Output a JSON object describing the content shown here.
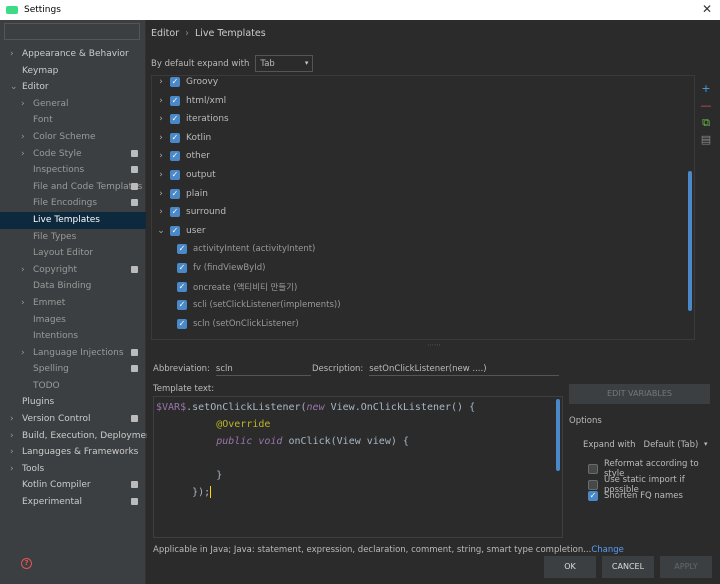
{
  "window": {
    "title": "Settings",
    "controls": "✕"
  },
  "sidebar": {
    "search_placeholder": "",
    "items": [
      {
        "label": "Appearance & Behavior",
        "level": 0,
        "arrow": "›",
        "badge": false
      },
      {
        "label": "Keymap",
        "level": 0,
        "arrow": "",
        "badge": false
      },
      {
        "label": "Editor",
        "level": 0,
        "arrow": "⌄",
        "badge": false
      },
      {
        "label": "General",
        "level": 1,
        "arrow": "›",
        "badge": false
      },
      {
        "label": "Font",
        "level": 1,
        "arrow": "",
        "badge": false
      },
      {
        "label": "Color Scheme",
        "level": 1,
        "arrow": "›",
        "badge": false
      },
      {
        "label": "Code Style",
        "level": 1,
        "arrow": "›",
        "badge": true
      },
      {
        "label": "Inspections",
        "level": 1,
        "arrow": "",
        "badge": true
      },
      {
        "label": "File and Code Templates",
        "level": 1,
        "arrow": "",
        "badge": true
      },
      {
        "label": "File Encodings",
        "level": 1,
        "arrow": "",
        "badge": true
      },
      {
        "label": "Live Templates",
        "level": 1,
        "arrow": "",
        "badge": false,
        "selected": true
      },
      {
        "label": "File Types",
        "level": 1,
        "arrow": "",
        "badge": false
      },
      {
        "label": "Layout Editor",
        "level": 1,
        "arrow": "",
        "badge": false
      },
      {
        "label": "Copyright",
        "level": 1,
        "arrow": "›",
        "badge": true
      },
      {
        "label": "Data Binding",
        "level": 1,
        "arrow": "",
        "badge": false
      },
      {
        "label": "Emmet",
        "level": 1,
        "arrow": "›",
        "badge": false
      },
      {
        "label": "Images",
        "level": 1,
        "arrow": "",
        "badge": false
      },
      {
        "label": "Intentions",
        "level": 1,
        "arrow": "",
        "badge": false
      },
      {
        "label": "Language Injections",
        "level": 1,
        "arrow": "›",
        "badge": true
      },
      {
        "label": "Spelling",
        "level": 1,
        "arrow": "",
        "badge": true
      },
      {
        "label": "TODO",
        "level": 1,
        "arrow": "",
        "badge": false
      },
      {
        "label": "Plugins",
        "level": 0,
        "arrow": "",
        "badge": false
      },
      {
        "label": "Version Control",
        "level": 0,
        "arrow": "›",
        "badge": true
      },
      {
        "label": "Build, Execution, Deployment",
        "level": 0,
        "arrow": "›",
        "badge": false
      },
      {
        "label": "Languages & Frameworks",
        "level": 0,
        "arrow": "›",
        "badge": false
      },
      {
        "label": "Tools",
        "level": 0,
        "arrow": "›",
        "badge": false
      },
      {
        "label": "Kotlin Compiler",
        "level": 0,
        "arrow": "",
        "badge": true
      },
      {
        "label": "Experimental",
        "level": 0,
        "arrow": "",
        "badge": true
      }
    ]
  },
  "breadcrumb": {
    "parent": "Editor",
    "sep": "›",
    "current": "Live Templates"
  },
  "expand_default": {
    "label": "By default expand with",
    "value": "Tab",
    "dd": "▾"
  },
  "templates": [
    {
      "label": "Groovy",
      "group": true,
      "arrow": "›"
    },
    {
      "label": "html/xml",
      "group": true,
      "arrow": "›"
    },
    {
      "label": "iterations",
      "group": true,
      "arrow": "›"
    },
    {
      "label": "Kotlin",
      "group": true,
      "arrow": "›"
    },
    {
      "label": "other",
      "group": true,
      "arrow": "›"
    },
    {
      "label": "output",
      "group": true,
      "arrow": "›"
    },
    {
      "label": "plain",
      "group": true,
      "arrow": "›"
    },
    {
      "label": "surround",
      "group": true,
      "arrow": "›"
    },
    {
      "label": "user",
      "group": true,
      "arrow": "⌄"
    },
    {
      "label": "activityIntent (activityIntent)",
      "group": false,
      "arrow": ""
    },
    {
      "label": "fv (findViewById)",
      "group": false,
      "arrow": ""
    },
    {
      "label": "oncreate (액티비티 만들기)",
      "group": false,
      "arrow": ""
    },
    {
      "label": "scli (setClickListener(implements))",
      "group": false,
      "arrow": ""
    },
    {
      "label": "scln (setOnClickListener)",
      "group": false,
      "arrow": ""
    }
  ],
  "tools": {
    "add": "+",
    "remove": "—",
    "copy": "⧉",
    "restore": "▤"
  },
  "check_mark": "✓",
  "abbreviation": {
    "label": "Abbreviation:",
    "value": "scln"
  },
  "description": {
    "label": "Description:",
    "value": "setOnClickListener(new ....)"
  },
  "template_text": {
    "label": "Template text:",
    "l1_var": "$VAR$",
    "l1_rest": ".setOnClickListener(",
    "l1_kw": "new",
    "l1_end": " View.OnClickListener() {",
    "l2_ann": "@Override",
    "l3_kw1": "public",
    "l3_kw2": "void",
    "l3_rest": " onClick(View view) {",
    "l5": "}",
    "l6": "});"
  },
  "edit_variables": "EDIT VARIABLES",
  "options": {
    "label": "Options",
    "expand_label": "Expand with",
    "expand_value": "Default (Tab)",
    "reformat": "Reformat according to style",
    "static_import": "Use static import if possible",
    "shorten_fq": "Shorten FQ names"
  },
  "applicable": {
    "text": "Applicable in Java; Java: statement, expression, declaration, comment, string, smart type completion...",
    "link": "Change"
  },
  "buttons": {
    "ok": "OK",
    "cancel": "CANCEL",
    "apply": "APPLY"
  },
  "help": "?"
}
